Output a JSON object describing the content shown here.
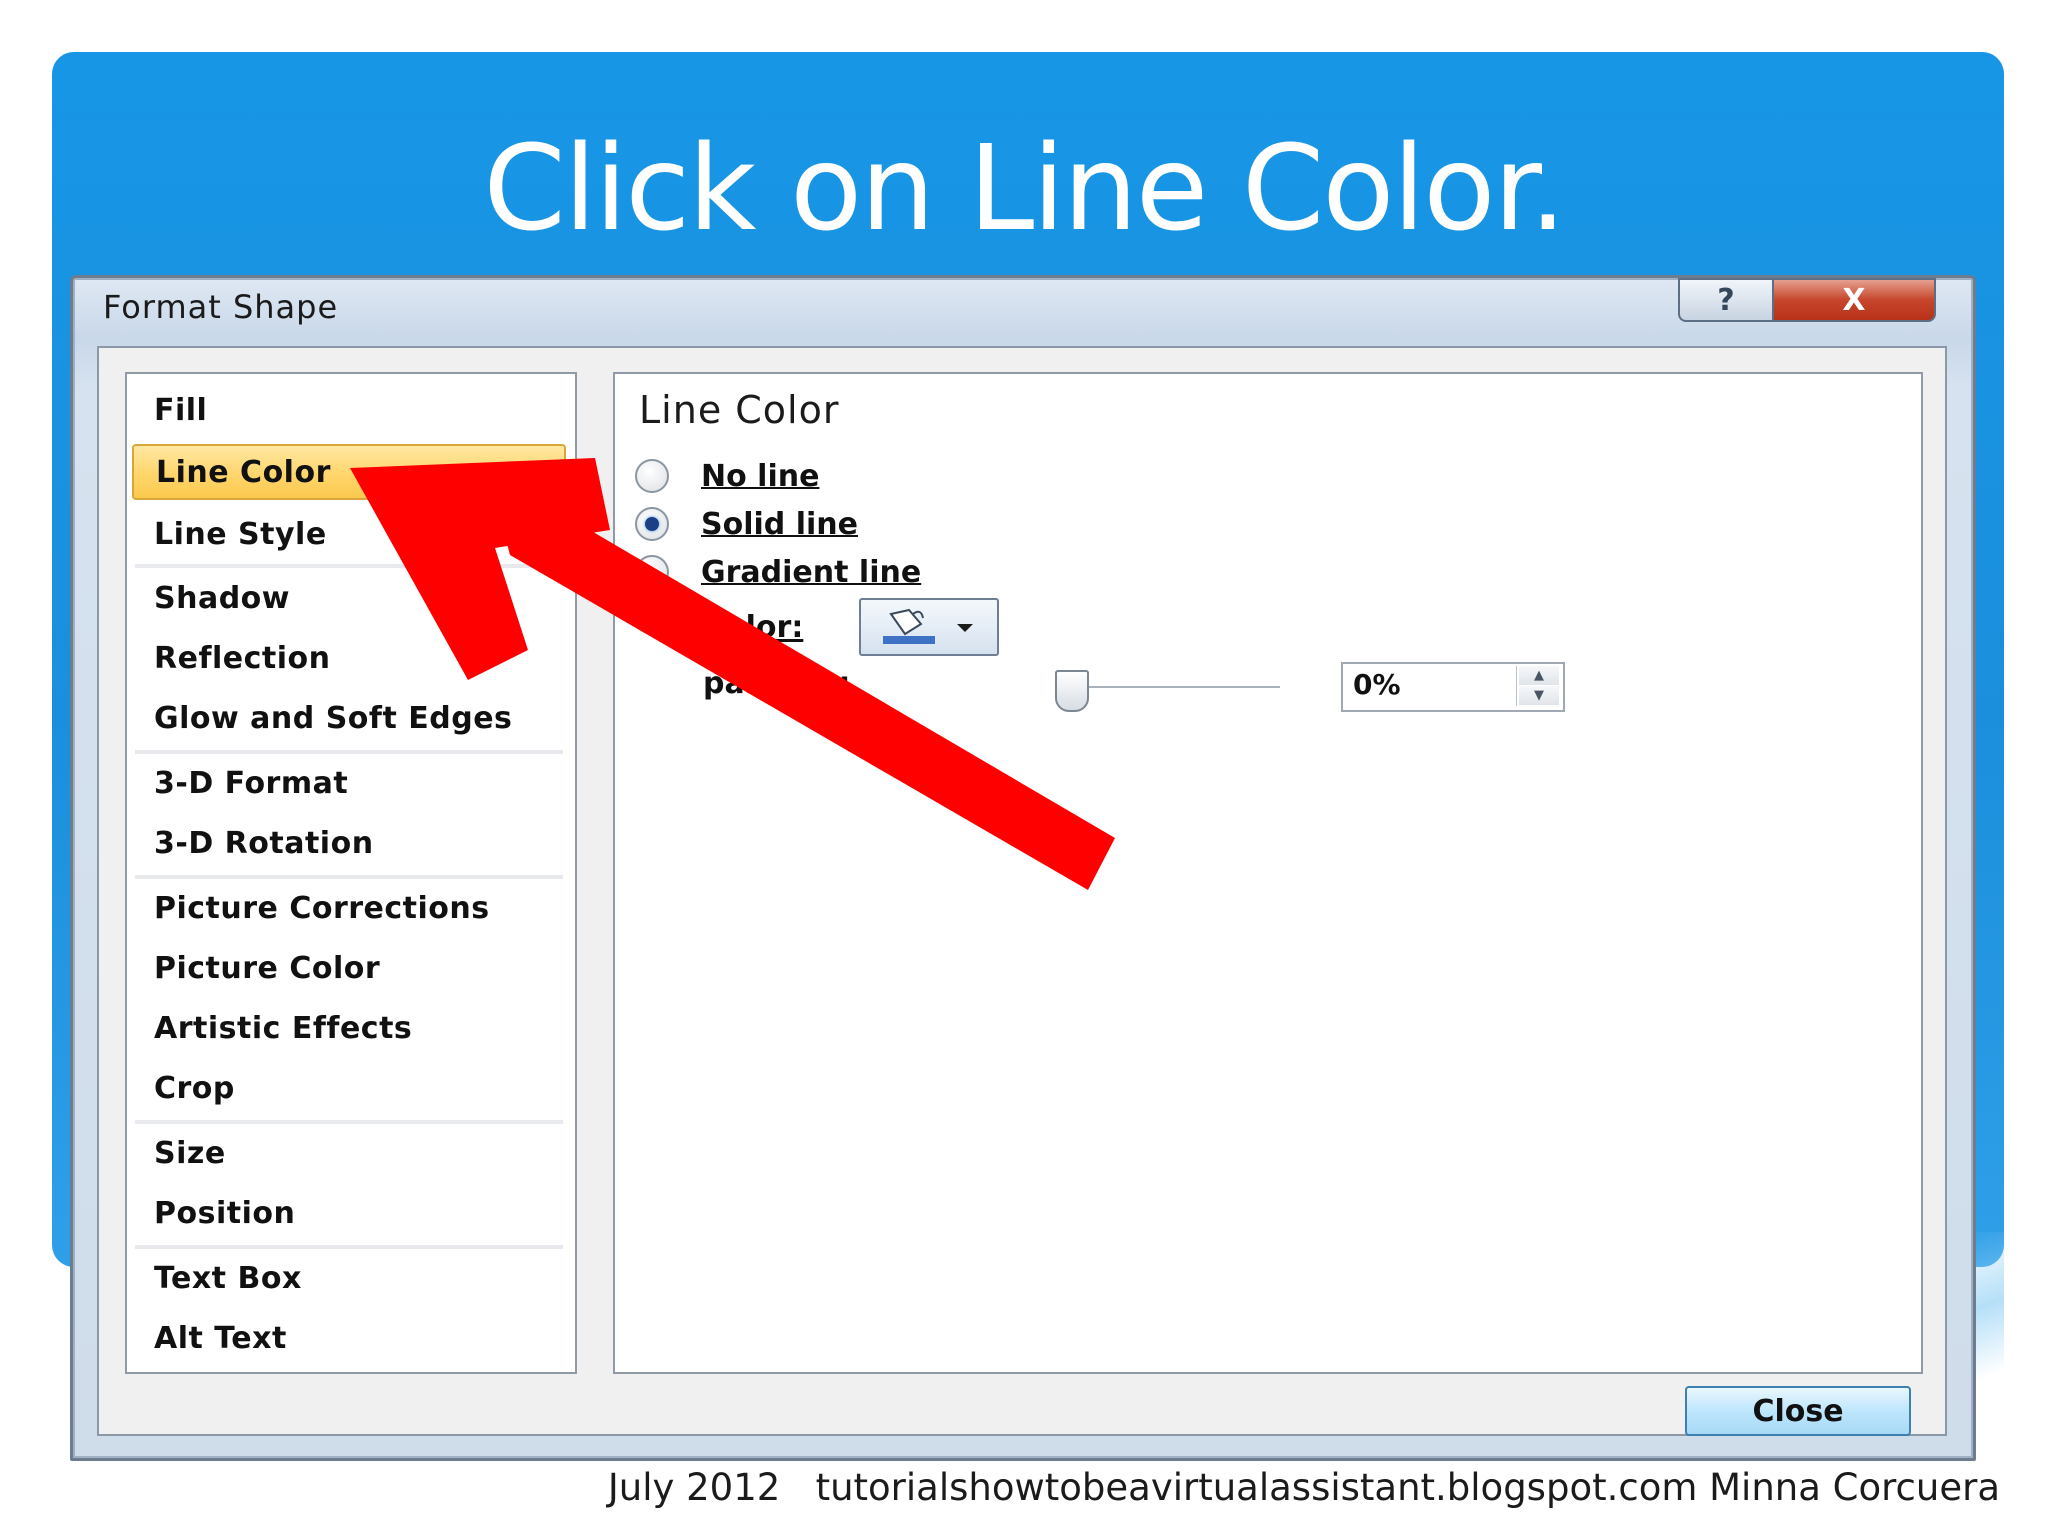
{
  "slide": {
    "title": "Click on Line Color.",
    "footer": "July 2012   tutorialshowtobeavirtualassistant.blogspot.com Minna Corcuera",
    "accent_color": "#1b8fdc",
    "annotation_arrow_color": "#ff0000"
  },
  "dialog": {
    "title": "Format Shape",
    "help_glyph": "?",
    "close_glyph": "X",
    "nav_items": [
      {
        "label": "Fill",
        "selected": false
      },
      {
        "label": "Line Color",
        "selected": true
      },
      {
        "label": "Line Style",
        "selected": false
      },
      {
        "label": "Shadow",
        "selected": false
      },
      {
        "label": "Reflection",
        "selected": false
      },
      {
        "label": "Glow and Soft Edges",
        "selected": false
      },
      {
        "label": "3-D Format",
        "selected": false
      },
      {
        "label": "3-D Rotation",
        "selected": false
      },
      {
        "label": "Picture Corrections",
        "selected": false
      },
      {
        "label": "Picture Color",
        "selected": false
      },
      {
        "label": "Artistic Effects",
        "selected": false
      },
      {
        "label": "Crop",
        "selected": false
      },
      {
        "label": "Size",
        "selected": false
      },
      {
        "label": "Position",
        "selected": false
      },
      {
        "label": "Text Box",
        "selected": false
      },
      {
        "label": "Alt Text",
        "selected": false
      }
    ],
    "panel": {
      "heading": "Line Color",
      "options": [
        {
          "label": "No line",
          "checked": false
        },
        {
          "label": "Solid line",
          "checked": true
        },
        {
          "label": "Gradient line",
          "checked": false
        }
      ],
      "color_label": "Color:",
      "color_swatch": "#3f72c4",
      "transparency_label_visible": "parency:",
      "transparency_value": "0%",
      "transparency_level": 0
    },
    "close_button": "Close"
  }
}
